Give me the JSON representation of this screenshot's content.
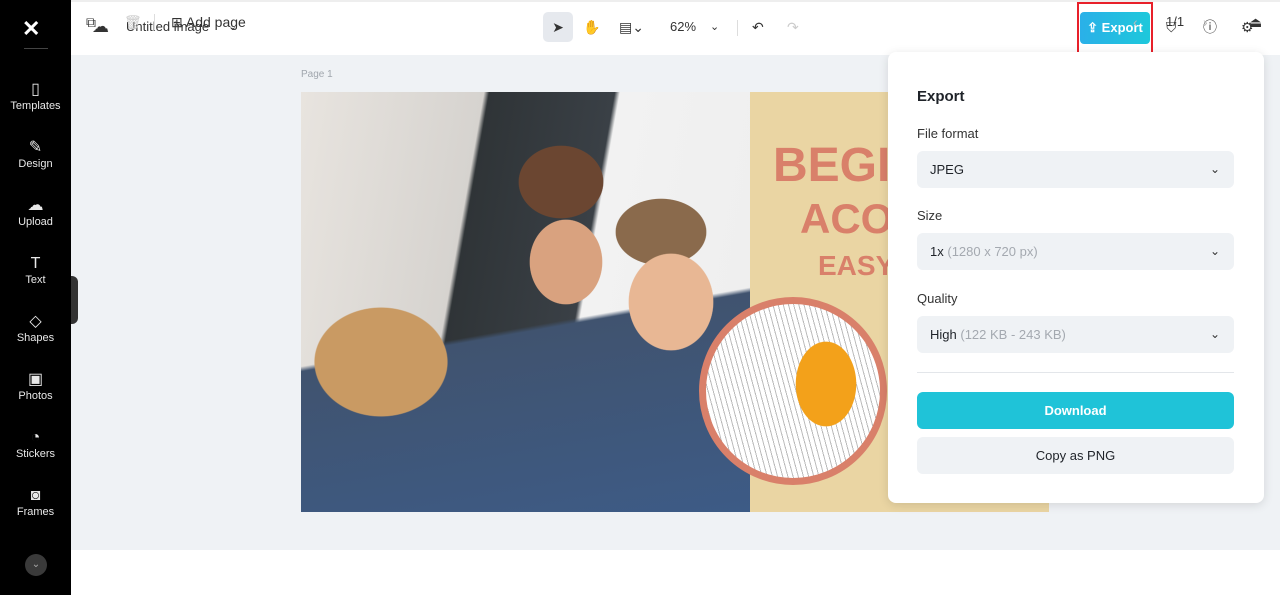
{
  "sidebar": {
    "items": [
      {
        "label": "Templates",
        "icon": "templates-icon"
      },
      {
        "label": "Design",
        "icon": "design-icon"
      },
      {
        "label": "Upload",
        "icon": "upload-icon"
      },
      {
        "label": "Text",
        "icon": "text-icon"
      },
      {
        "label": "Shapes",
        "icon": "shapes-icon"
      },
      {
        "label": "Photos",
        "icon": "photos-icon"
      },
      {
        "label": "Stickers",
        "icon": "stickers-icon"
      },
      {
        "label": "Frames",
        "icon": "frames-icon"
      }
    ]
  },
  "header": {
    "title": "Untitled image",
    "zoom": "62%",
    "export_label": "Export"
  },
  "canvas": {
    "page_label": "Page 1",
    "headline": [
      "BEGI",
      "ACO",
      "EASY"
    ]
  },
  "export_panel": {
    "title": "Export",
    "file_format_label": "File format",
    "file_format": "JPEG",
    "size_label": "Size",
    "size_value": "1x",
    "size_detail": "(1280 x 720 px)",
    "quality_label": "Quality",
    "quality_value": "High",
    "quality_detail": "(122 KB - 243 KB)",
    "download_label": "Download",
    "copy_label": "Copy as PNG"
  },
  "footer": {
    "add_page": "Add page",
    "page_counter": "1/1"
  },
  "colors": {
    "accent": "#1fc3d8",
    "highlight": "#e8202a",
    "headline": "#d9806a"
  }
}
